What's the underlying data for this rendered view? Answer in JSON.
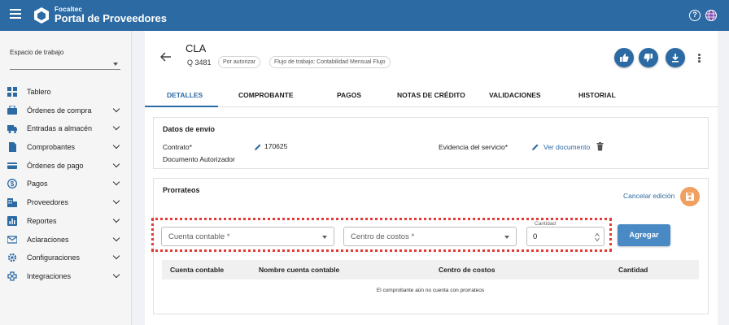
{
  "header": {
    "brand_small": "Focaltec",
    "brand_title": "Portal de Proveedores",
    "help_glyph": "?",
    "icons": [
      "menu-icon",
      "logo-icon",
      "help-icon",
      "globe-icon"
    ]
  },
  "sidebar": {
    "workspace_label": "Espacio de trabajo",
    "workspace_value": "",
    "items": [
      {
        "label": "Tablero",
        "icon": "dashboard-icon",
        "expandable": false
      },
      {
        "label": "Órdenes de compra",
        "icon": "cart-icon",
        "expandable": true
      },
      {
        "label": "Entradas a almacén",
        "icon": "truck-icon",
        "expandable": true
      },
      {
        "label": "Comprobantes",
        "icon": "document-icon",
        "expandable": true
      },
      {
        "label": "Órdenes de pago",
        "icon": "card-icon",
        "expandable": true
      },
      {
        "label": "Pagos",
        "icon": "dollar-icon",
        "expandable": true
      },
      {
        "label": "Proveedores",
        "icon": "building-icon",
        "expandable": true
      },
      {
        "label": "Reportes",
        "icon": "report-icon",
        "expandable": true
      },
      {
        "label": "Aclaraciones",
        "icon": "mail-icon",
        "expandable": true
      },
      {
        "label": "Configuraciones",
        "icon": "gear-icon",
        "expandable": true
      },
      {
        "label": "Integraciones",
        "icon": "integration-icon",
        "expandable": true
      }
    ]
  },
  "document": {
    "title": "CLA",
    "id": "Q 3481",
    "status_chip": "Por autorizar",
    "workflow_chip": "Flujo de trabajo: Contabilidad Mensual Flujo"
  },
  "tabs": [
    {
      "label": "DETALLES",
      "active": true
    },
    {
      "label": "COMPROBANTE",
      "active": false
    },
    {
      "label": "PAGOS",
      "active": false
    },
    {
      "label": "NOTAS DE CRÉDITO",
      "active": false
    },
    {
      "label": "VALIDACIONES",
      "active": false
    },
    {
      "label": "HISTORIAL",
      "active": false
    }
  ],
  "shipping": {
    "title": "Datos de envío",
    "contract_label": "Contrato*",
    "contract_value": "170625",
    "authorized_doc_label": "Documento Autorizador",
    "evidence_label": "Evidencia del servicio*",
    "evidence_link": "Ver documento"
  },
  "prorrateos": {
    "title": "Prorrateos",
    "cancel_label": "Cancelar edición",
    "account_placeholder": "Cuenta contable *",
    "cost_center_placeholder": "Centro de costos *",
    "quantity_label": "Cantidad",
    "quantity_value": "0",
    "add_label": "Agregar",
    "columns": [
      "Cuenta contable",
      "Nombre cuenta contable",
      "Centro de costos",
      "Cantidad"
    ],
    "empty_message": "El comprobante aún no cuenta con prorrateos"
  },
  "colors": {
    "primary": "#2c6aa3",
    "accent_orange": "#f0a060",
    "highlight_red": "#e53935"
  }
}
